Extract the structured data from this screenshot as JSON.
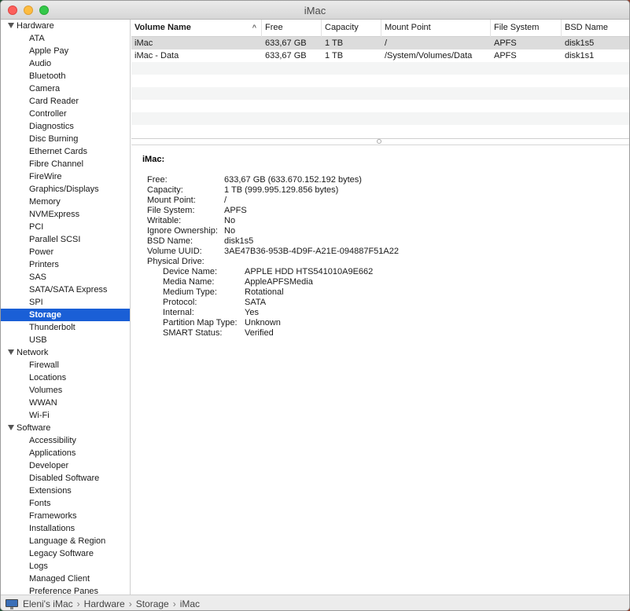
{
  "window": {
    "title": "iMac"
  },
  "sidebar": {
    "sections": [
      {
        "label": "Hardware",
        "items": [
          "ATA",
          "Apple Pay",
          "Audio",
          "Bluetooth",
          "Camera",
          "Card Reader",
          "Controller",
          "Diagnostics",
          "Disc Burning",
          "Ethernet Cards",
          "Fibre Channel",
          "FireWire",
          "Graphics/Displays",
          "Memory",
          "NVMExpress",
          "PCI",
          "Parallel SCSI",
          "Power",
          "Printers",
          "SAS",
          "SATA/SATA Express",
          "SPI",
          "Storage",
          "Thunderbolt",
          "USB"
        ]
      },
      {
        "label": "Network",
        "items": [
          "Firewall",
          "Locations",
          "Volumes",
          "WWAN",
          "Wi-Fi"
        ]
      },
      {
        "label": "Software",
        "items": [
          "Accessibility",
          "Applications",
          "Developer",
          "Disabled Software",
          "Extensions",
          "Fonts",
          "Frameworks",
          "Installations",
          "Language & Region",
          "Legacy Software",
          "Logs",
          "Managed Client",
          "Preference Panes"
        ]
      }
    ],
    "selected": "Storage"
  },
  "table": {
    "columns": [
      "Volume Name",
      "Free",
      "Capacity",
      "Mount Point",
      "File System",
      "BSD Name"
    ],
    "sort_column": "Volume Name",
    "sort_glyph": "^",
    "rows": [
      [
        "iMac",
        "633,67 GB",
        "1 TB",
        "/",
        "APFS",
        "disk1s5"
      ],
      [
        "iMac - Data",
        "633,67 GB",
        "1 TB",
        "/System/Volumes/Data",
        "APFS",
        "disk1s1"
      ]
    ]
  },
  "detail": {
    "title": "iMac:",
    "fields": [
      {
        "key": "Free:",
        "value": "633,67 GB (633.670.152.192 bytes)"
      },
      {
        "key": "Capacity:",
        "value": "1 TB (999.995.129.856 bytes)"
      },
      {
        "key": "Mount Point:",
        "value": "/"
      },
      {
        "key": "File System:",
        "value": "APFS"
      },
      {
        "key": "Writable:",
        "value": "No"
      },
      {
        "key": "Ignore Ownership:",
        "value": "No"
      },
      {
        "key": "BSD Name:",
        "value": "disk1s5"
      },
      {
        "key": "Volume UUID:",
        "value": "3AE47B36-953B-4D9F-A21E-094887F51A22"
      },
      {
        "key": "Physical Drive:",
        "value": ""
      }
    ],
    "drive_fields": [
      {
        "key": "Device Name:",
        "value": "APPLE HDD HTS541010A9E662"
      },
      {
        "key": "Media Name:",
        "value": "AppleAPFSMedia"
      },
      {
        "key": "Medium Type:",
        "value": "Rotational"
      },
      {
        "key": "Protocol:",
        "value": "SATA"
      },
      {
        "key": "Internal:",
        "value": "Yes"
      },
      {
        "key": "Partition Map Type:",
        "value": "Unknown"
      },
      {
        "key": "SMART Status:",
        "value": "Verified"
      }
    ]
  },
  "statusbar": {
    "path": [
      "Eleni's iMac",
      "Hardware",
      "Storage",
      "iMac"
    ],
    "separator": "›"
  }
}
